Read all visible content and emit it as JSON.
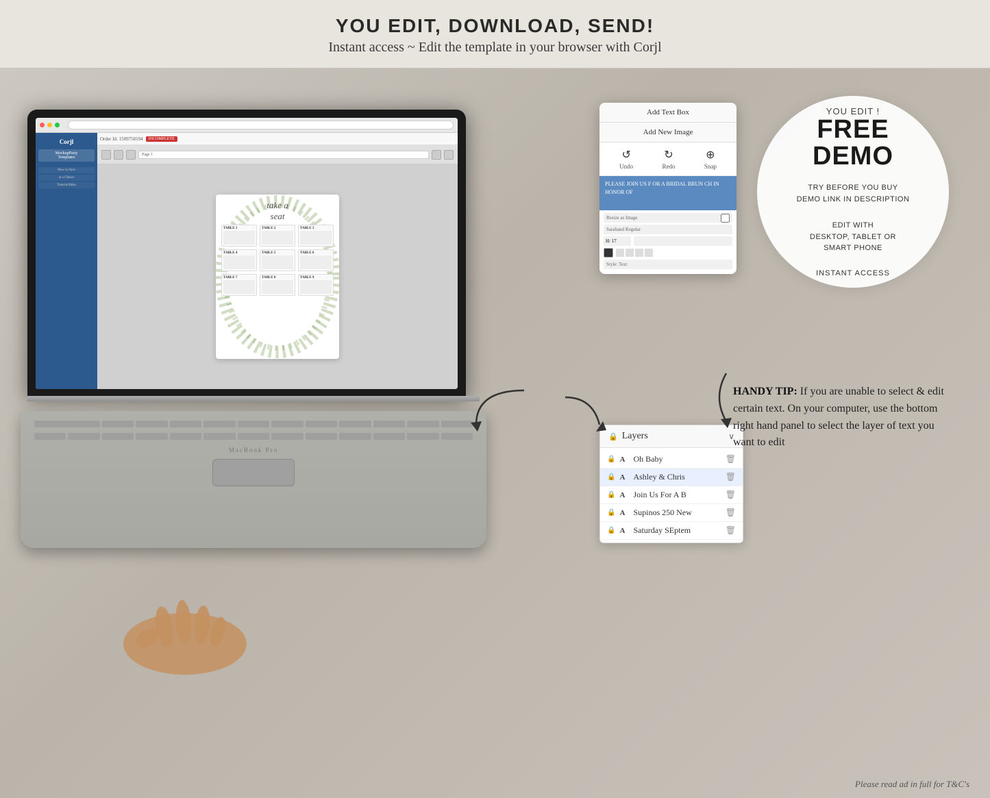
{
  "header": {
    "title": "YOU EDIT, DOWNLOAD, SEND!",
    "subtitle": "Instant access ~ Edit the template in your browser with Corjl"
  },
  "demo_circle": {
    "you_edit_label": "YOU EDIT !",
    "free_label": "FREE",
    "demo_label": "DEMO",
    "try_label": "TRY BEFORE YOU BUY",
    "demo_link_label": "DEMO LINK IN DESCRIPTION",
    "edit_with_label": "EDIT WITH",
    "devices_label": "DESKTOP, TABLET OR",
    "smart_phone_label": "SMART PHONE",
    "instant_label": "INSTANT ACCESS"
  },
  "phone_panel": {
    "add_text_btn": "Add Text Box",
    "add_image_btn": "Add New Image",
    "undo_label": "Undo",
    "redo_label": "Redo",
    "snap_label": "Snap",
    "text_preview": "PLEASE JOIN US F\nOR A BRIDAL BRUN\nCH\nIN HONOR OF"
  },
  "layers_panel": {
    "title": "Layers",
    "items": [
      {
        "name": "Oh Baby",
        "type": "A",
        "selected": false
      },
      {
        "name": "Ashley & Chris",
        "type": "A",
        "selected": true
      },
      {
        "name": "Join Us For A B",
        "type": "A",
        "selected": false
      },
      {
        "name": "Supinos 250 New",
        "type": "A",
        "selected": false
      },
      {
        "name": "Saturday SEptem",
        "type": "A",
        "selected": false
      }
    ]
  },
  "handy_tip": {
    "label": "HANDY TIP:",
    "text": " If you are unable to select & edit certain text. On your computer, use the bottom right hand panel to select the layer of text you want to edit"
  },
  "laptop": {
    "order_id": "Order Id: 1509758194",
    "incomplete_label": "INCOMPLETE",
    "seating_title": "take a seat",
    "tables": [
      {
        "label": "TABLE 1"
      },
      {
        "label": "TABLE 2"
      },
      {
        "label": "TABLE 3"
      },
      {
        "label": "TABLE 4"
      },
      {
        "label": "TABLE 5"
      },
      {
        "label": "TABLE 6"
      },
      {
        "label": "TABLE 7"
      },
      {
        "label": "TABLE 8"
      },
      {
        "label": "TABLE 9"
      }
    ]
  },
  "footer": {
    "text": "Please read ad in full for T&C's"
  },
  "icons": {
    "lock": "🔒",
    "chevron_down": "∨",
    "delete": "🗑",
    "undo": "↺",
    "redo": "↻",
    "snap": "⊕"
  }
}
